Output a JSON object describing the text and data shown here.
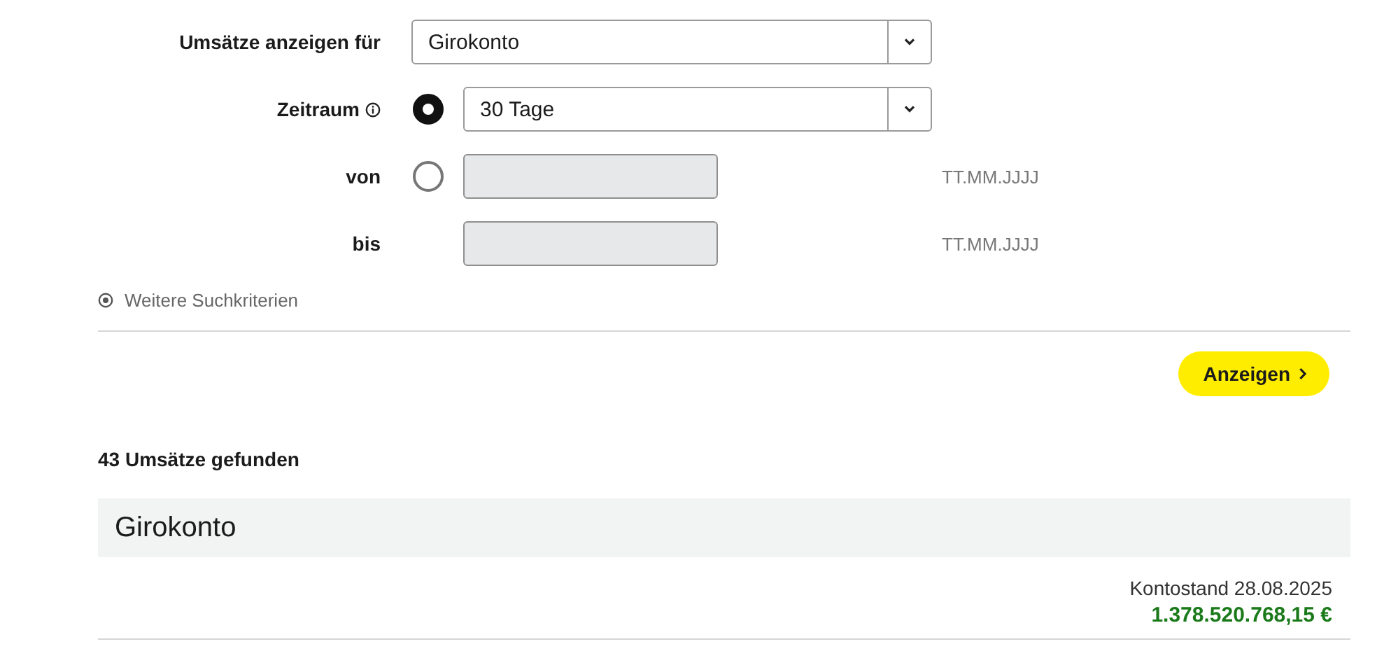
{
  "account_filter": {
    "label": "Umsätze anzeigen für",
    "value": "Girokonto"
  },
  "period": {
    "label": "Zeitraum",
    "selected": true,
    "value": "30 Tage"
  },
  "date_from": {
    "label": "von",
    "selected": false,
    "hint": "TT.MM.JJJJ"
  },
  "date_to": {
    "label": "bis",
    "hint": "TT.MM.JJJJ"
  },
  "more_criteria": {
    "label": "Weitere Suchkriterien"
  },
  "submit_button": {
    "label": "Anzeigen"
  },
  "result_count": "43 Umsätze gefunden",
  "account": {
    "name": "Girokonto",
    "balance_label": "Kontostand 28.08.2025",
    "balance": "1.378.520.768,15 €"
  }
}
